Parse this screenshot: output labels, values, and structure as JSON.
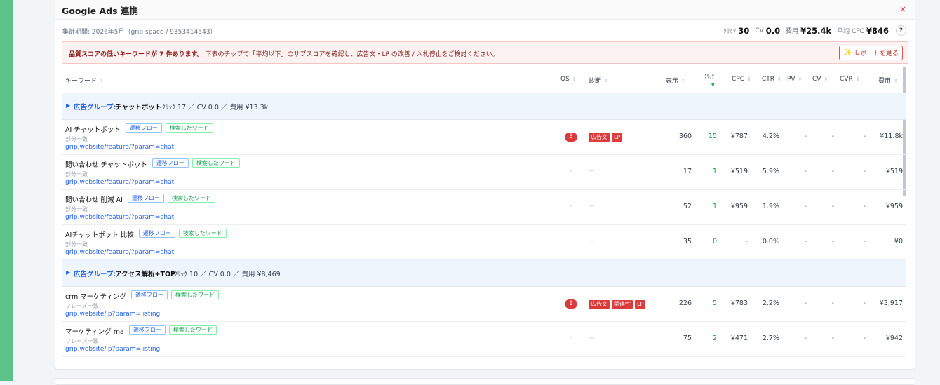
{
  "colors": {
    "accent": "#5cc48a",
    "link": "#2563eb",
    "positive": "#16a34a",
    "danger": "#dc3b3b"
  },
  "panel": {
    "title": "Google Ads 連携",
    "close_label": "×",
    "period": "集計期間: 2026年5月（grip space / 9353414543）",
    "summary": {
      "click_label": "ｸﾘｯｸ",
      "click_value": "30",
      "cv_label": "CV",
      "cv_value": "0.0",
      "cost_label": "費用",
      "cost_value": "¥25.4k",
      "cpc_label": "平均 CPC",
      "cpc_value": "¥846",
      "help_label": "?"
    },
    "alert": {
      "bold_text": "品質スコアの低いキーワードが 7 件あります。",
      "text": "下表のチップで「平均以下」のサブスコアを確認し、広告文・LP の改善 / 入札停止をご検討ください。",
      "button_icon": "sparkle-icon",
      "button_label": "レポートを見る"
    }
  },
  "table": {
    "columns": [
      "キーワード",
      "QS",
      "診断",
      "表示",
      "ｸﾘｯｸ",
      "CPC",
      "CTR",
      "PV",
      "CV",
      "CVR",
      "費用"
    ],
    "sorted_column": "ｸﾘｯｸ",
    "chip_flow": "遷移フロー",
    "chip_word": "検索したワード",
    "group_label": "広告グループ:",
    "groups": [
      {
        "name": "チャットボット",
        "stats": "ｸﾘｯｸ 17 ／ CV 0.0 ／ 費用 ¥13.3k",
        "rows": [
          {
            "keyword": "AI チャットボット",
            "match": "部分一致",
            "url": "grip.website/feature/?param=chat",
            "qs": "3",
            "tags": [
              "広告文",
              "LP"
            ],
            "impressions": "360",
            "clicks": "15",
            "cpc": "¥787",
            "ctr": "4.2%",
            "pv": "-",
            "cv": "-",
            "cvr": "-",
            "cost": "¥11.8k"
          },
          {
            "keyword": "問い合わせ チャットボット",
            "match": "部分一致",
            "url": "grip.website/feature/?param=chat",
            "qs": "-",
            "tags": [],
            "impressions": "17",
            "clicks": "1",
            "cpc": "¥519",
            "ctr": "5.9%",
            "pv": "-",
            "cv": "-",
            "cvr": "-",
            "cost": "¥519"
          },
          {
            "keyword": "問い合わせ 削減 AI",
            "match": "部分一致",
            "url": "grip.website/feature/?param=chat",
            "qs": "-",
            "tags": [],
            "impressions": "52",
            "clicks": "1",
            "cpc": "¥959",
            "ctr": "1.9%",
            "pv": "-",
            "cv": "-",
            "cvr": "-",
            "cost": "¥959"
          },
          {
            "keyword": "AIチャットボット 比較",
            "match": "部分一致",
            "url": "grip.website/feature/?param=chat",
            "qs": "-",
            "tags": [],
            "impressions": "35",
            "clicks": "0",
            "cpc": "-",
            "ctr": "0.0%",
            "pv": "-",
            "cv": "-",
            "cvr": "-",
            "cost": "¥0"
          }
        ]
      },
      {
        "name": "アクセス解析+TOP",
        "stats": "ｸﾘｯｸ 10 ／ CV 0.0 ／ 費用 ¥8,469",
        "rows": [
          {
            "keyword": "crm マーケティング",
            "match": "フレーズ一致",
            "url": "grip.website/lp?param=listing",
            "qs": "1",
            "tags": [
              "広告文",
              "関連性",
              "LP"
            ],
            "impressions": "226",
            "clicks": "5",
            "cpc": "¥783",
            "ctr": "2.2%",
            "pv": "-",
            "cv": "-",
            "cvr": "-",
            "cost": "¥3,917"
          },
          {
            "keyword": "マーケティング ma",
            "match": "フレーズ一致",
            "url": "grip.website/lp?param=listing",
            "qs": "-",
            "tags": [],
            "impressions": "75",
            "clicks": "2",
            "cpc": "¥471",
            "ctr": "2.7%",
            "pv": "-",
            "cv": "-",
            "cvr": "-",
            "cost": "¥942"
          }
        ]
      }
    ],
    "diag_empty": "—"
  }
}
